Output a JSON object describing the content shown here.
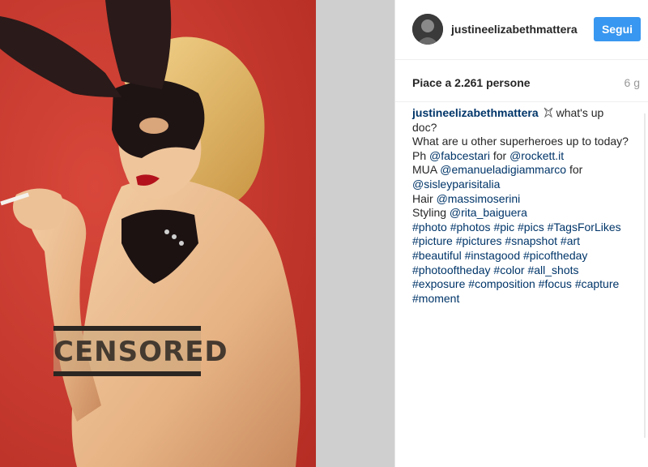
{
  "post": {
    "censor_label": "CENSORED"
  },
  "header": {
    "username": "justineelizabethmattera",
    "follow_label": "Segui"
  },
  "likes_row": {
    "likes": "Piace a 2.261 persone",
    "age": "6 g"
  },
  "caption": {
    "username": "justineelizabethmattera",
    "line1": "what's up doc?",
    "line2": "What are u other superheroes up to today?",
    "ph_prefix": "Ph ",
    "ph_mention": "@fabcestari",
    "ph_for": " for ",
    "ph_mention2": "@rockett.it",
    "mua_prefix": "MUA ",
    "mua_mention": "@emanueladigiammarco",
    "mua_for": " for ",
    "mua_mention2": "@sisleyparisitalia",
    "hair_prefix": "Hair ",
    "hair_mention": "@massimoserini",
    "styling_prefix": "Styling ",
    "styling_mention": "@rita_baiguera",
    "hashtags": [
      "#photo",
      "#photos",
      "#pic",
      "#pics",
      "#TagsForLikes",
      "#picture",
      "#pictures",
      "#snapshot",
      "#art",
      "#beautiful",
      "#instagood",
      "#picoftheday",
      "#photooftheday",
      "#color",
      "#all_shots",
      "#exposure",
      "#composition",
      "#focus",
      "#capture",
      "#moment"
    ]
  }
}
